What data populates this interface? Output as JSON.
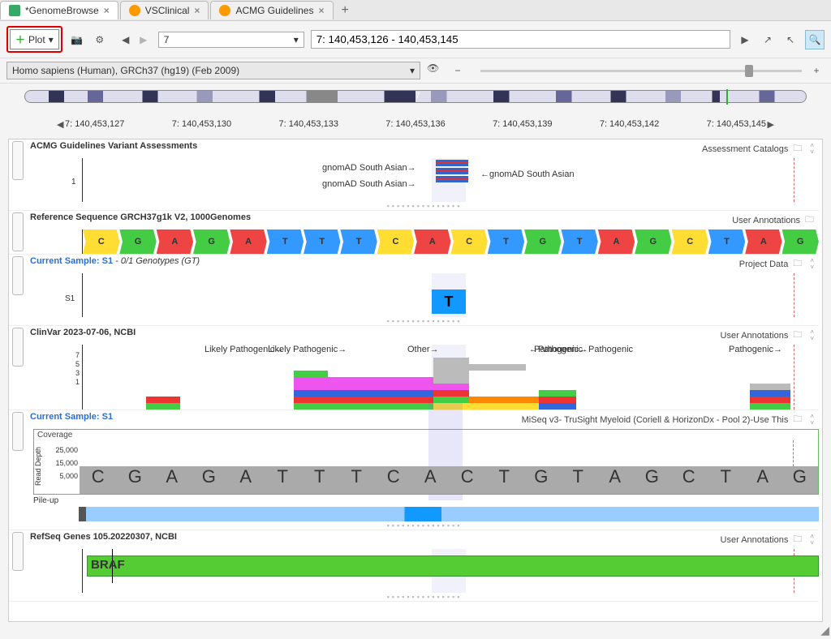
{
  "tabs": {
    "items": [
      {
        "label": "*GenomeBrowse",
        "icon": "gb",
        "active": true
      },
      {
        "label": "VSClinical",
        "icon": "gs",
        "active": false
      },
      {
        "label": "ACMG Guidelines",
        "icon": "gs",
        "active": false
      }
    ]
  },
  "toolbar": {
    "plot_label": "Plot",
    "chrom_value": "7",
    "position_value": "7: 140,453,126 - 140,453,145"
  },
  "genome": {
    "assembly": "Homo sapiens (Human), GRCh37 (hg19) (Feb 2009)",
    "chrom_badge": "7"
  },
  "ruler": {
    "ticks": [
      "7: 140,453,127",
      "7: 140,453,130",
      "7: 140,453,133",
      "7: 140,453,136",
      "7: 140,453,139",
      "7: 140,453,142",
      "7: 140,453,145"
    ]
  },
  "tracks": {
    "acmg": {
      "title": "ACMG Guidelines Variant Assessments",
      "right_label": "Assessment Catalogs",
      "axis": "1",
      "pop_label_left1": "gnomAD South Asian→",
      "pop_label_left2": "gnomAD South Asian→",
      "pop_label_right": "←gnomAD South Asian"
    },
    "refseq": {
      "title": "Reference Sequence GRCH37g1k V2, 1000Genomes",
      "right_label": "User Annotations",
      "bases": [
        "C",
        "G",
        "A",
        "G",
        "A",
        "T",
        "T",
        "T",
        "C",
        "A",
        "C",
        "T",
        "G",
        "T",
        "A",
        "G",
        "C",
        "T",
        "A",
        "G"
      ]
    },
    "geno": {
      "title_prefix": "Current Sample:",
      "sample": "S1",
      "detail": "- 0/1 Genotypes (GT)",
      "right_label": "Project Data",
      "axis": "S1",
      "allele": "T"
    },
    "clinvar": {
      "title": "ClinVar 2023-07-06, NCBI",
      "right_label": "User Annotations",
      "axis": [
        "7",
        "5",
        "3",
        "1"
      ],
      "labels": {
        "other": "Other→",
        "pathogenic1": "←Pathogenic",
        "likely1": "Likely Pathogenic→",
        "likely2": "Likely Pathogenic→",
        "pathogenic2": "Pathogenic→",
        "pathogenic3": "←Pathogenic",
        "pathogenic4": "Pathogenic→"
      }
    },
    "coverage": {
      "title_prefix": "Current Sample:",
      "sample": "S1",
      "right_label": "MiSeq v3- TruSight Myeloid (Coriell & HorizonDx - Pool 2)-Use This",
      "subtitle": "Coverage",
      "vaxis_label": "Read Depth",
      "axis": [
        "25,000",
        "15,000",
        "5,000"
      ],
      "bases": [
        "C",
        "G",
        "A",
        "G",
        "A",
        "T",
        "T",
        "T",
        "C",
        "A",
        "C",
        "T",
        "G",
        "T",
        "A",
        "G",
        "C",
        "T",
        "A",
        "G"
      ]
    },
    "pileup": {
      "title": "Pile-up"
    },
    "gene": {
      "title": "RefSeq Genes 105.20220307, NCBI",
      "right_label": "User Annotations",
      "name": "BRAF"
    }
  }
}
